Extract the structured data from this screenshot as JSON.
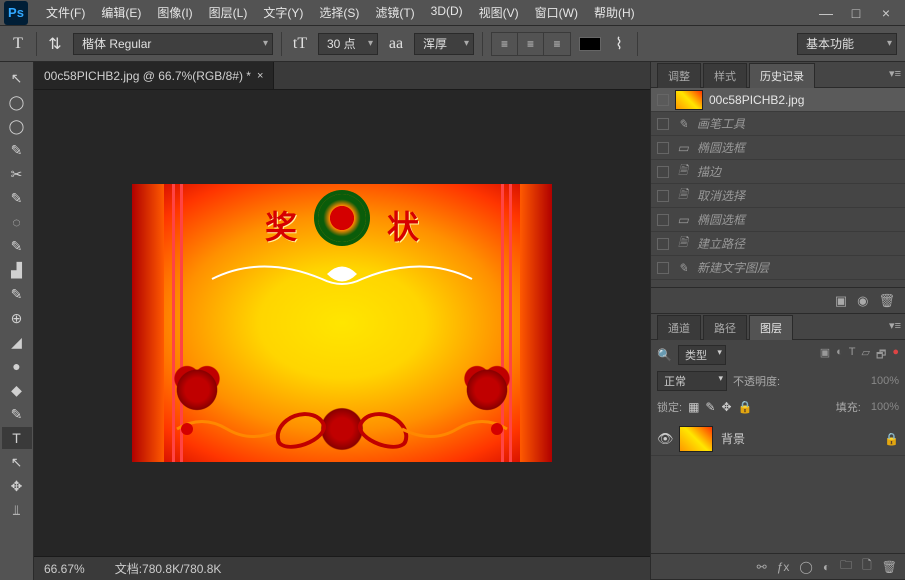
{
  "app": {
    "logo": "Ps"
  },
  "menu": [
    "文件(F)",
    "编辑(E)",
    "图像(I)",
    "图层(L)",
    "文字(Y)",
    "选择(S)",
    "滤镜(T)",
    "3D(D)",
    "视图(V)",
    "窗口(W)",
    "帮助(H)"
  ],
  "options": {
    "tool_glyph": "T",
    "font": "楷体 Regular",
    "size_glyph": "tT",
    "size": "30 点",
    "aa_glyph": "aa",
    "antialias": "浑厚",
    "workspace": "基本功能"
  },
  "document": {
    "tab_title": "00c58PICHB2.jpg @ 66.7%(RGB/8#) *",
    "certificate_left": "奖",
    "certificate_right": "状"
  },
  "status": {
    "zoom": "66.67%",
    "docinfo": "文档:780.8K/780.8K"
  },
  "panels": {
    "history": {
      "tabs": [
        "调整",
        "样式",
        "历史记录"
      ],
      "active_tab": 2,
      "items": [
        {
          "label": "00c58PICHB2.jpg",
          "icon": "brush",
          "thumb": true,
          "current": true
        },
        {
          "label": "画笔工具",
          "icon": "brush"
        },
        {
          "label": "椭圆选框",
          "icon": "marquee"
        },
        {
          "label": "描边",
          "icon": "doc"
        },
        {
          "label": "取消选择",
          "icon": "doc"
        },
        {
          "label": "椭圆选框",
          "icon": "marquee"
        },
        {
          "label": "建立路径",
          "icon": "doc"
        },
        {
          "label": "新建文字图层",
          "icon": "brush"
        }
      ]
    },
    "layers": {
      "tabs": [
        "通道",
        "路径",
        "图层"
      ],
      "active_tab": 2,
      "filter_label": "类型",
      "blend_mode": "正常",
      "opacity_label": "不透明度:",
      "opacity_value": "100%",
      "lock_label": "锁定:",
      "fill_label": "填充:",
      "fill_value": "100%",
      "items": [
        {
          "name": "背景",
          "locked": true
        }
      ]
    }
  },
  "tools": [
    "↖",
    "◯",
    "◯",
    "✎",
    "✂",
    "✎",
    "◌",
    "✎",
    "▟",
    "✎",
    "⊕",
    "◢",
    "●",
    "◆",
    "✎",
    "T",
    "↖",
    "✥",
    "⫫"
  ]
}
